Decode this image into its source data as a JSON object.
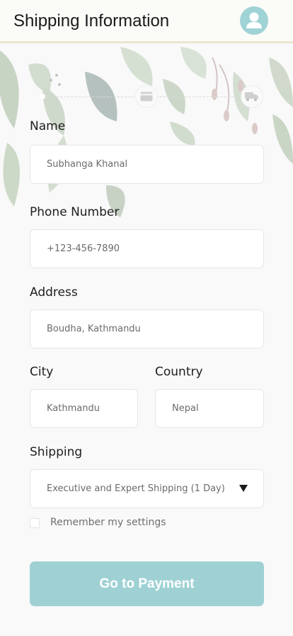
{
  "header": {
    "title": "Shipping Information",
    "avatar_icon": "user-icon"
  },
  "progress": {
    "steps": [
      "shipping",
      "payment-card-icon",
      "delivery-truck-icon"
    ]
  },
  "form": {
    "name": {
      "label": "Name",
      "value": "Subhanga Khanal"
    },
    "phone": {
      "label": "Phone Number",
      "value": "+123-456-7890"
    },
    "address": {
      "label": "Address",
      "value": "Boudha, Kathmandu"
    },
    "city": {
      "label": "City",
      "value": "Kathmandu"
    },
    "country": {
      "label": "Country",
      "value": "Nepal"
    },
    "shipping": {
      "label": "Shipping",
      "value": "Executive and Expert Shipping (1 Day)"
    },
    "remember": {
      "label": "Remember my settings",
      "checked": false
    }
  },
  "actions": {
    "submit_label": "Go to Payment"
  },
  "colors": {
    "accent": "#9fd1d4",
    "background": "#f9f9f9",
    "header_border": "#ece5cf"
  }
}
